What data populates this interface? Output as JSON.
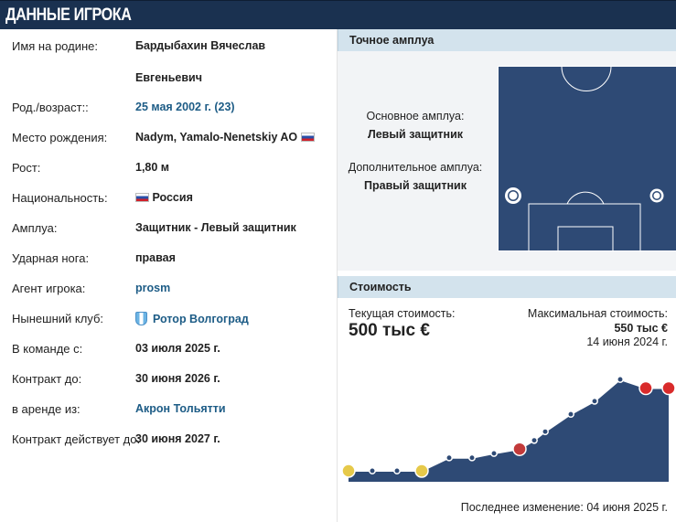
{
  "header": {
    "title": "ДАННЫЕ ИГРОКА"
  },
  "info": {
    "rows": [
      {
        "label": "Имя на родине:",
        "value": "Бардыбахин Вячеслав",
        "value2": "Евгеньевич"
      },
      {
        "label": "Род./возраст::",
        "value": "25 мая 2002 г. (23)"
      },
      {
        "label": "Место рождения:",
        "value": "Nadym, Yamalo-Nenetskiy AO"
      },
      {
        "label": "Рост:",
        "value": "1,80 м"
      },
      {
        "label": "Национальность:",
        "value": "Россия"
      },
      {
        "label": "Амплуа:",
        "value": "Защитник - Левый защитник"
      },
      {
        "label": "Ударная нога:",
        "value": "правая"
      },
      {
        "label": "Агент игрока:",
        "value": "prosm"
      },
      {
        "label": "Нынешний клуб:",
        "value": "Ротор Волгоград"
      },
      {
        "label": "В команде с:",
        "value": "03 июля 2025 г."
      },
      {
        "label": "Контракт до:",
        "value": "30 июня 2026 г."
      },
      {
        "label": "в аренде из:",
        "value": "Акрон Тольятти"
      },
      {
        "label": "Контракт действует до:",
        "value": "30 июня 2027 г."
      }
    ]
  },
  "position": {
    "title": "Точное амплуа",
    "main_label": "Основное амплуа:",
    "main_value": "Левый защитник",
    "other_label": "Дополнительное амплуа:",
    "other_value": "Правый защитник",
    "pitch_color": "#2e4a75"
  },
  "market": {
    "title": "Стоимость",
    "current_label": "Текущая стоимость:",
    "current_value": "500 тыс €",
    "max_label": "Максимальная стоимость:",
    "max_value": "550 тыс €",
    "max_date": "14 июня 2024 г.",
    "last_change": "Последнее изменение: 04 июня 2025 г."
  },
  "chart_data": {
    "type": "area",
    "values": [
      25,
      25,
      25,
      25,
      100,
      100,
      125,
      150,
      200,
      250,
      350,
      425,
      550,
      500,
      500
    ],
    "fill_color": "#2e4a75",
    "line_color": "#ffffff"
  },
  "colors": {
    "header_bg": "#1a3150",
    "link": "#1d5c86",
    "section_head": "#d3e3ed"
  }
}
